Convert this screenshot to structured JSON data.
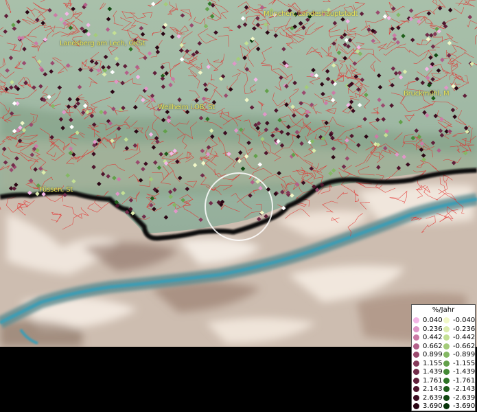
{
  "map": {
    "places": {
      "muenchen": "München, Landeshauptstadt",
      "landsberg": "Landsberg am Lech, GKSt",
      "weilheim": "Weilheim i.OB, St",
      "bruckmuehl": "Bruckmühl, M",
      "fuessen": "Füssen, St"
    }
  },
  "legend": {
    "title": "%/Jahr",
    "positive": [
      {
        "label": "0.040",
        "color": "#f4b6e6"
      },
      {
        "label": "0.236",
        "color": "#e096c8"
      },
      {
        "label": "0.442",
        "color": "#cc7aa6"
      },
      {
        "label": "0.662",
        "color": "#b3608a"
      },
      {
        "label": "0.899",
        "color": "#9a4a6e"
      },
      {
        "label": "1.155",
        "color": "#853a5a"
      },
      {
        "label": "1.439",
        "color": "#722c4a"
      },
      {
        "label": "1.761",
        "color": "#601f3a"
      },
      {
        "label": "2.143",
        "color": "#4e152c"
      },
      {
        "label": "2.639",
        "color": "#3b0c20"
      },
      {
        "label": "3.690",
        "color": "#2a0614"
      }
    ],
    "negative": [
      {
        "label": "-0.040",
        "color": "#f2f8c8"
      },
      {
        "label": "-0.236",
        "color": "#dcecac"
      },
      {
        "label": "-0.442",
        "color": "#c4e094"
      },
      {
        "label": "-0.662",
        "color": "#a4cc7a"
      },
      {
        "label": "-0.899",
        "color": "#84b864"
      },
      {
        "label": "-1.155",
        "color": "#62a04a"
      },
      {
        "label": "-1.439",
        "color": "#448a36"
      },
      {
        "label": "-1.761",
        "color": "#2e7426"
      },
      {
        "label": "-2.143",
        "color": "#1e5e1a"
      },
      {
        "label": "-2.639",
        "color": "#114812"
      },
      {
        "label": "-3.690",
        "color": "#08340a"
      }
    ]
  }
}
